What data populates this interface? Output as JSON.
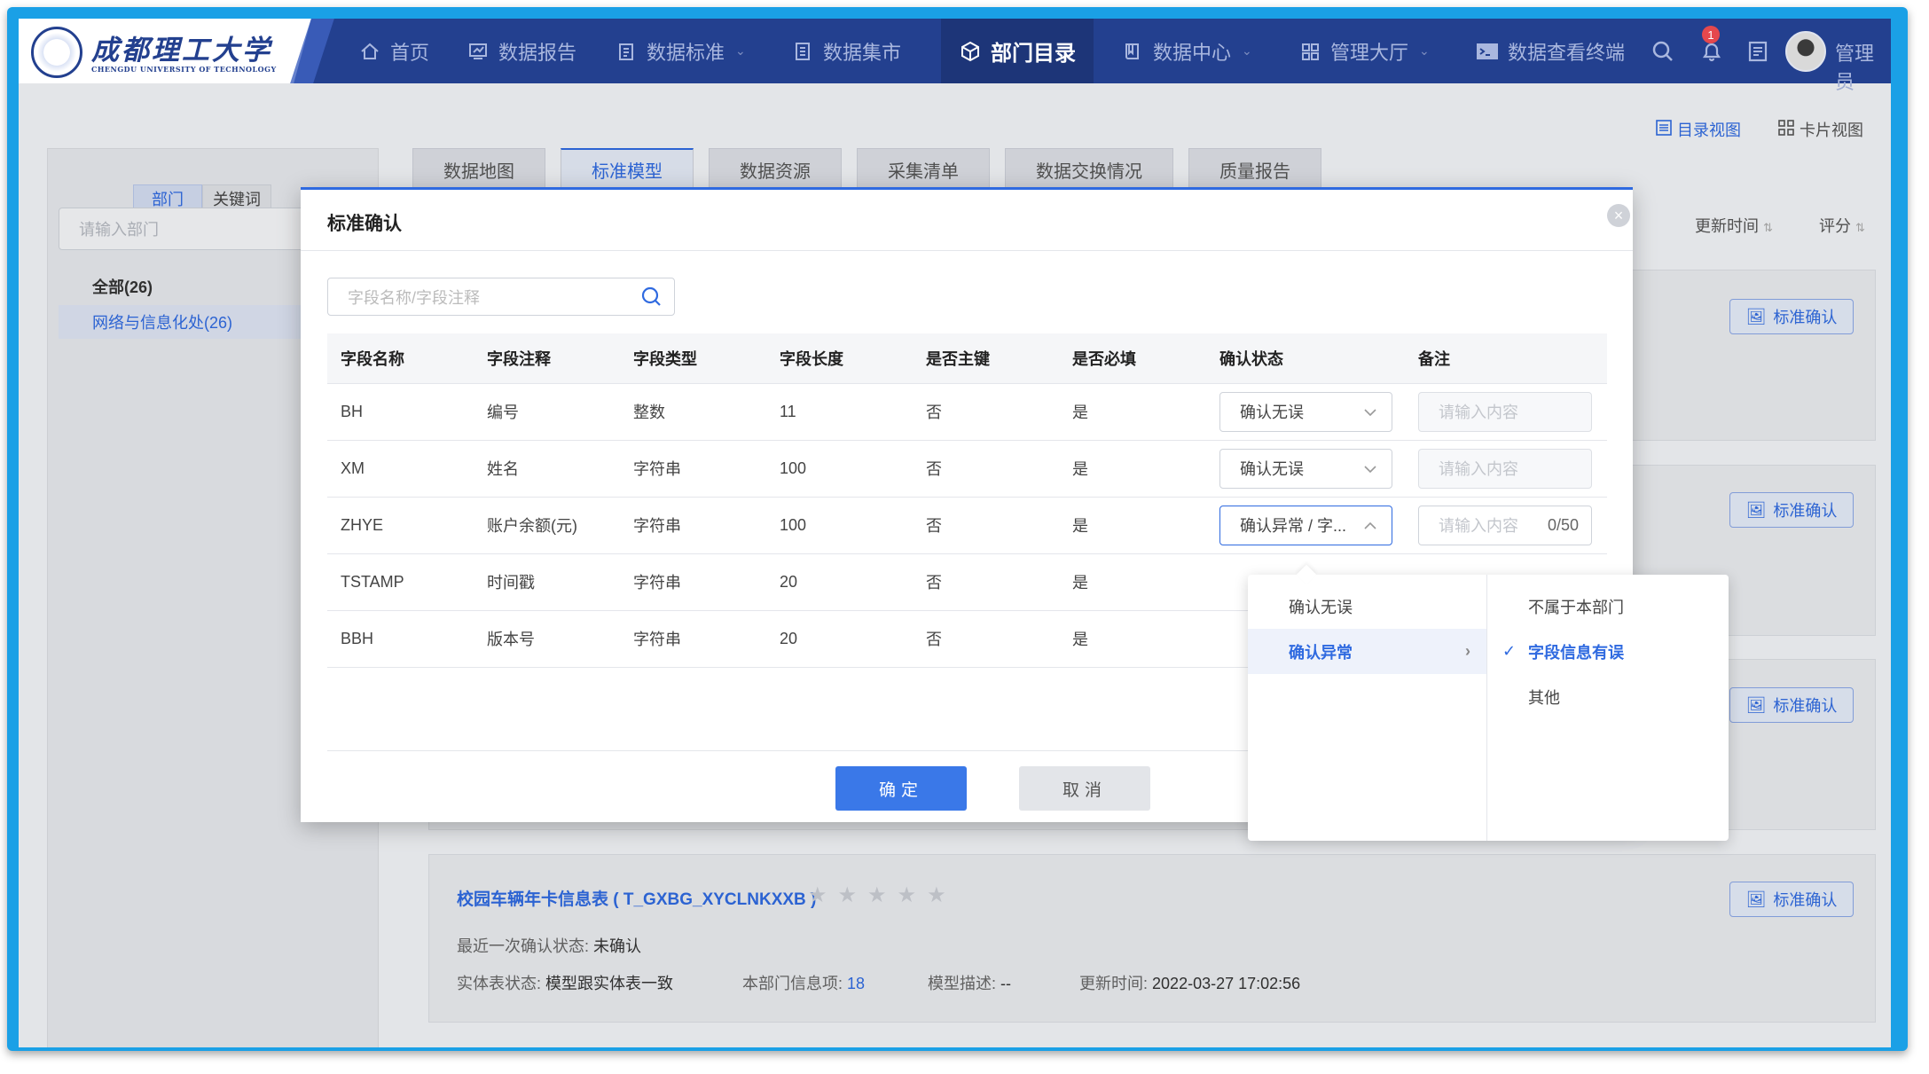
{
  "logo": {
    "cn": "成都理工大学",
    "en": "CHENGDU UNIVERSITY OF TECHNOLOGY"
  },
  "nav": [
    {
      "label": "首页",
      "icon": "home-icon",
      "caret": false
    },
    {
      "label": "数据报告",
      "icon": "report-icon",
      "caret": false
    },
    {
      "label": "数据标准",
      "icon": "clipboard-icon",
      "caret": true
    },
    {
      "label": "数据集市",
      "icon": "document-icon",
      "caret": false
    },
    {
      "label": "部门目录",
      "icon": "cube-icon",
      "caret": false,
      "active": true
    },
    {
      "label": "数据中心",
      "icon": "book-icon",
      "caret": true
    },
    {
      "label": "管理大厅",
      "icon": "grid-icon",
      "caret": true
    },
    {
      "label": "数据查看终端",
      "icon": "terminal-icon",
      "caret": false
    }
  ],
  "notifications": {
    "count": "1"
  },
  "user": {
    "name": "管理员"
  },
  "views": {
    "catalog": "目录视图",
    "card": "卡片视图"
  },
  "left": {
    "seg_dept": "部门",
    "seg_keyword": "关键词",
    "search_placeholder": "请输入部门",
    "all": "全部(26)",
    "dept": "网络与信息化处(26)"
  },
  "tabs": [
    "数据地图",
    "标准模型",
    "数据资源",
    "采集清单",
    "数据交换情况",
    "质量报告"
  ],
  "sort": {
    "updated": "更新时间",
    "rating": "评分"
  },
  "std_confirm_btn": "标准确认",
  "bottom_card": {
    "title": "校园车辆年卡信息表 ( T_GXBG_XYCLNKXXB )",
    "last_status_label": "最近一次确认状态:",
    "last_status": "未确认",
    "entity_label": "实体表状态:",
    "entity": "模型跟实体表一致",
    "items_label": "本部门信息项:",
    "items": "18",
    "desc_label": "模型描述:",
    "desc": "--",
    "time_label": "更新时间:",
    "time": "2022-03-27 17:02:56"
  },
  "modal": {
    "title": "标准确认",
    "search_placeholder": "字段名称/字段注释",
    "columns": [
      "字段名称",
      "字段注释",
      "字段类型",
      "字段长度",
      "是否主键",
      "是否必填",
      "确认状态",
      "备注"
    ],
    "rows": [
      {
        "name": "BH",
        "comment": "编号",
        "type": "整数",
        "length": "11",
        "pk": "否",
        "required": "是",
        "status": "确认无误",
        "remark_placeholder": "请输入内容",
        "remark_count": ""
      },
      {
        "name": "XM",
        "comment": "姓名",
        "type": "字符串",
        "length": "100",
        "pk": "否",
        "required": "是",
        "status": "确认无误",
        "remark_placeholder": "请输入内容",
        "remark_count": ""
      },
      {
        "name": "ZHYE",
        "comment": "账户余额(元)",
        "type": "字符串",
        "length": "100",
        "pk": "否",
        "required": "是",
        "status": "确认异常 / 字...",
        "remark_placeholder": "请输入内容",
        "remark_count": "0/50"
      },
      {
        "name": "TSTAMP",
        "comment": "时间戳",
        "type": "字符串",
        "length": "20",
        "pk": "否",
        "required": "是",
        "status": "",
        "remark_placeholder": "",
        "remark_count": ""
      },
      {
        "name": "BBH",
        "comment": "版本号",
        "type": "字符串",
        "length": "20",
        "pk": "否",
        "required": "是",
        "status": "",
        "remark_placeholder": "",
        "remark_count": ""
      }
    ],
    "ok": "确定",
    "cancel": "取消"
  },
  "cascader": {
    "level1": [
      "确认无误",
      "确认异常"
    ],
    "level2": [
      "不属于本部门",
      "字段信息有误",
      "其他"
    ],
    "selected_level1": "确认异常",
    "selected_level2": "字段信息有误"
  },
  "colors": {
    "nav_bg": "#23408f",
    "accent": "#2f6ae0",
    "frame": "#1aa0e6"
  }
}
